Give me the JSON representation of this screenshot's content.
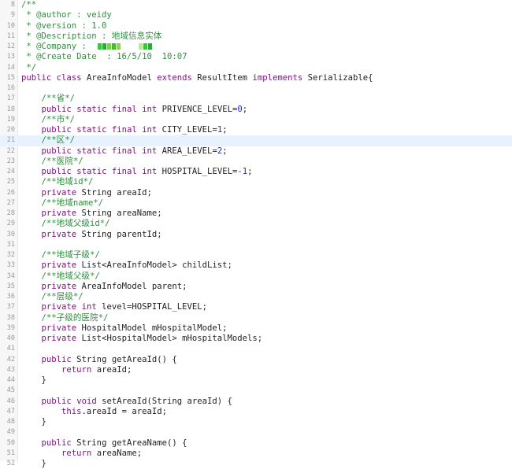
{
  "editor": {
    "lines": [
      {
        "n": "8",
        "t": "/**"
      },
      {
        "n": "9",
        "t": " * @author : veidy"
      },
      {
        "n": "10",
        "t": " * @version : 1.0"
      },
      {
        "n": "11",
        "t": " * @Description : 地域信息实体"
      },
      {
        "n": "12",
        "t": " * @Company :"
      },
      {
        "n": "13",
        "t": " * @Create Date  : 16/5/10  10:07"
      },
      {
        "n": "14",
        "t": " */"
      },
      {
        "n": "15",
        "t": "public class AreaInfoModel extends ResultItem implements Serializable{"
      },
      {
        "n": "16",
        "t": ""
      },
      {
        "n": "17",
        "t": "    /**省*/"
      },
      {
        "n": "18",
        "t": "    public static final int PRIVENCE_LEVEL=0;"
      },
      {
        "n": "19",
        "t": "    /**市*/"
      },
      {
        "n": "20",
        "t": "    public static final int CITY_LEVEL=1;"
      },
      {
        "n": "21",
        "t": "    /**区*/"
      },
      {
        "n": "22",
        "t": "    public static final int AREA_LEVEL=2;"
      },
      {
        "n": "23",
        "t": "    /**医院*/"
      },
      {
        "n": "24",
        "t": "    public static final int HOSPITAL_LEVEL=-1;"
      },
      {
        "n": "25",
        "t": "    /**地域id*/"
      },
      {
        "n": "26",
        "t": "    private String areaId;"
      },
      {
        "n": "27",
        "t": "    /**地域name*/"
      },
      {
        "n": "28",
        "t": "    private String areaName;"
      },
      {
        "n": "29",
        "t": "    /**地域父级id*/"
      },
      {
        "n": "30",
        "t": "    private String parentId;"
      },
      {
        "n": "31",
        "t": ""
      },
      {
        "n": "32",
        "t": "    /**地域子级*/"
      },
      {
        "n": "33",
        "t": "    private List<AreaInfoModel> childList;"
      },
      {
        "n": "34",
        "t": "    /**地域父级*/"
      },
      {
        "n": "35",
        "t": "    private AreaInfoModel parent;"
      },
      {
        "n": "36",
        "t": "    /**层级*/"
      },
      {
        "n": "37",
        "t": "    private int level=HOSPITAL_LEVEL;"
      },
      {
        "n": "38",
        "t": "    /**子级的医院*/"
      },
      {
        "n": "39",
        "t": "    private HospitalModel mHospitalModel;"
      },
      {
        "n": "40",
        "t": "    private List<HospitalModel> mHospitalModels;"
      },
      {
        "n": "41",
        "t": ""
      },
      {
        "n": "42",
        "t": "    public String getAreaId() {"
      },
      {
        "n": "43",
        "t": "        return areaId;"
      },
      {
        "n": "44",
        "t": "    }"
      },
      {
        "n": "45",
        "t": ""
      },
      {
        "n": "46",
        "t": "    public void setAreaId(String areaId) {"
      },
      {
        "n": "47",
        "t": "        this.areaId = areaId;"
      },
      {
        "n": "48",
        "t": "    }"
      },
      {
        "n": "49",
        "t": ""
      },
      {
        "n": "50",
        "t": "    public String getAreaName() {"
      },
      {
        "n": "51",
        "t": "        return areaName;"
      },
      {
        "n": "52",
        "t": "    }"
      }
    ],
    "current_line": "21",
    "colors": {
      "keyword": "#7f0f7f",
      "comment": "#2f8f3f",
      "number": "#1f2fbf",
      "text": "#1f1f1f",
      "line_number": "#9a9a9a",
      "current_line_bg": "#e8f2fe"
    }
  }
}
